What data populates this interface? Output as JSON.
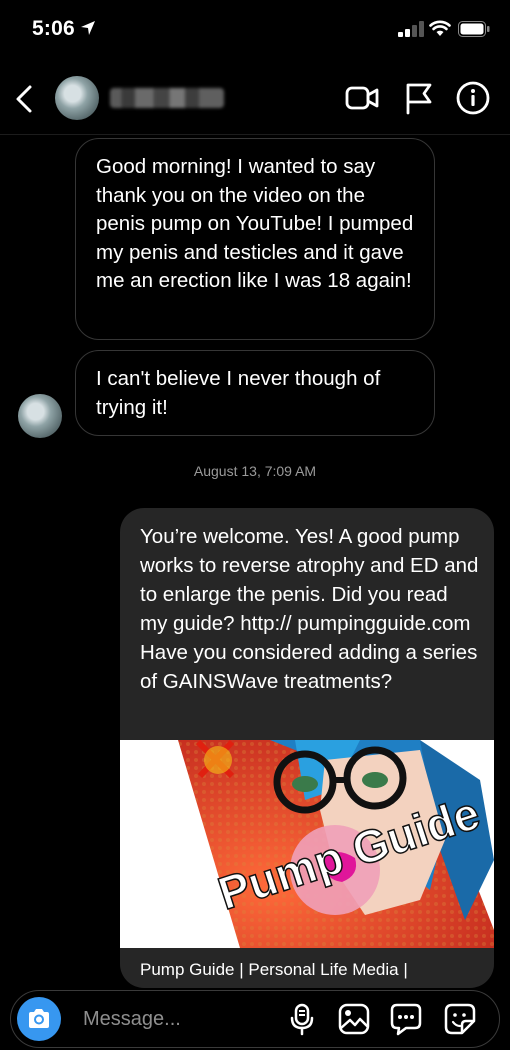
{
  "status_bar": {
    "time": "5:06"
  },
  "header": {
    "icons": [
      "back-chevron-icon",
      "video-call-icon",
      "flag-icon",
      "info-icon"
    ]
  },
  "messages": [
    {
      "direction": "incoming",
      "text": "Good morning! I wanted to say thank you on the video on the penis pump on YouTube! I pumped my penis and testicles and it gave me an erection like I was 18 again!"
    },
    {
      "direction": "incoming",
      "text": "I can't believe I never though of trying it!"
    },
    {
      "direction": "outgoing",
      "text": "You’re welcome. Yes! A good pump works to reverse atrophy and ED and to enlarge the penis. Did you read my guide? http:// pumpingguide.com Have you considered adding a series of GAINSWave treatments?"
    }
  ],
  "timestamp": "August 13, 7:09 AM",
  "link_preview": {
    "image_text": "Pump Guide",
    "title": "Pump Guide | Personal Life Media |"
  },
  "composer": {
    "placeholder": "Message..."
  },
  "colors": {
    "background": "#000000",
    "outgoing_bubble": "#262626",
    "camera_button": "#3797f0"
  }
}
